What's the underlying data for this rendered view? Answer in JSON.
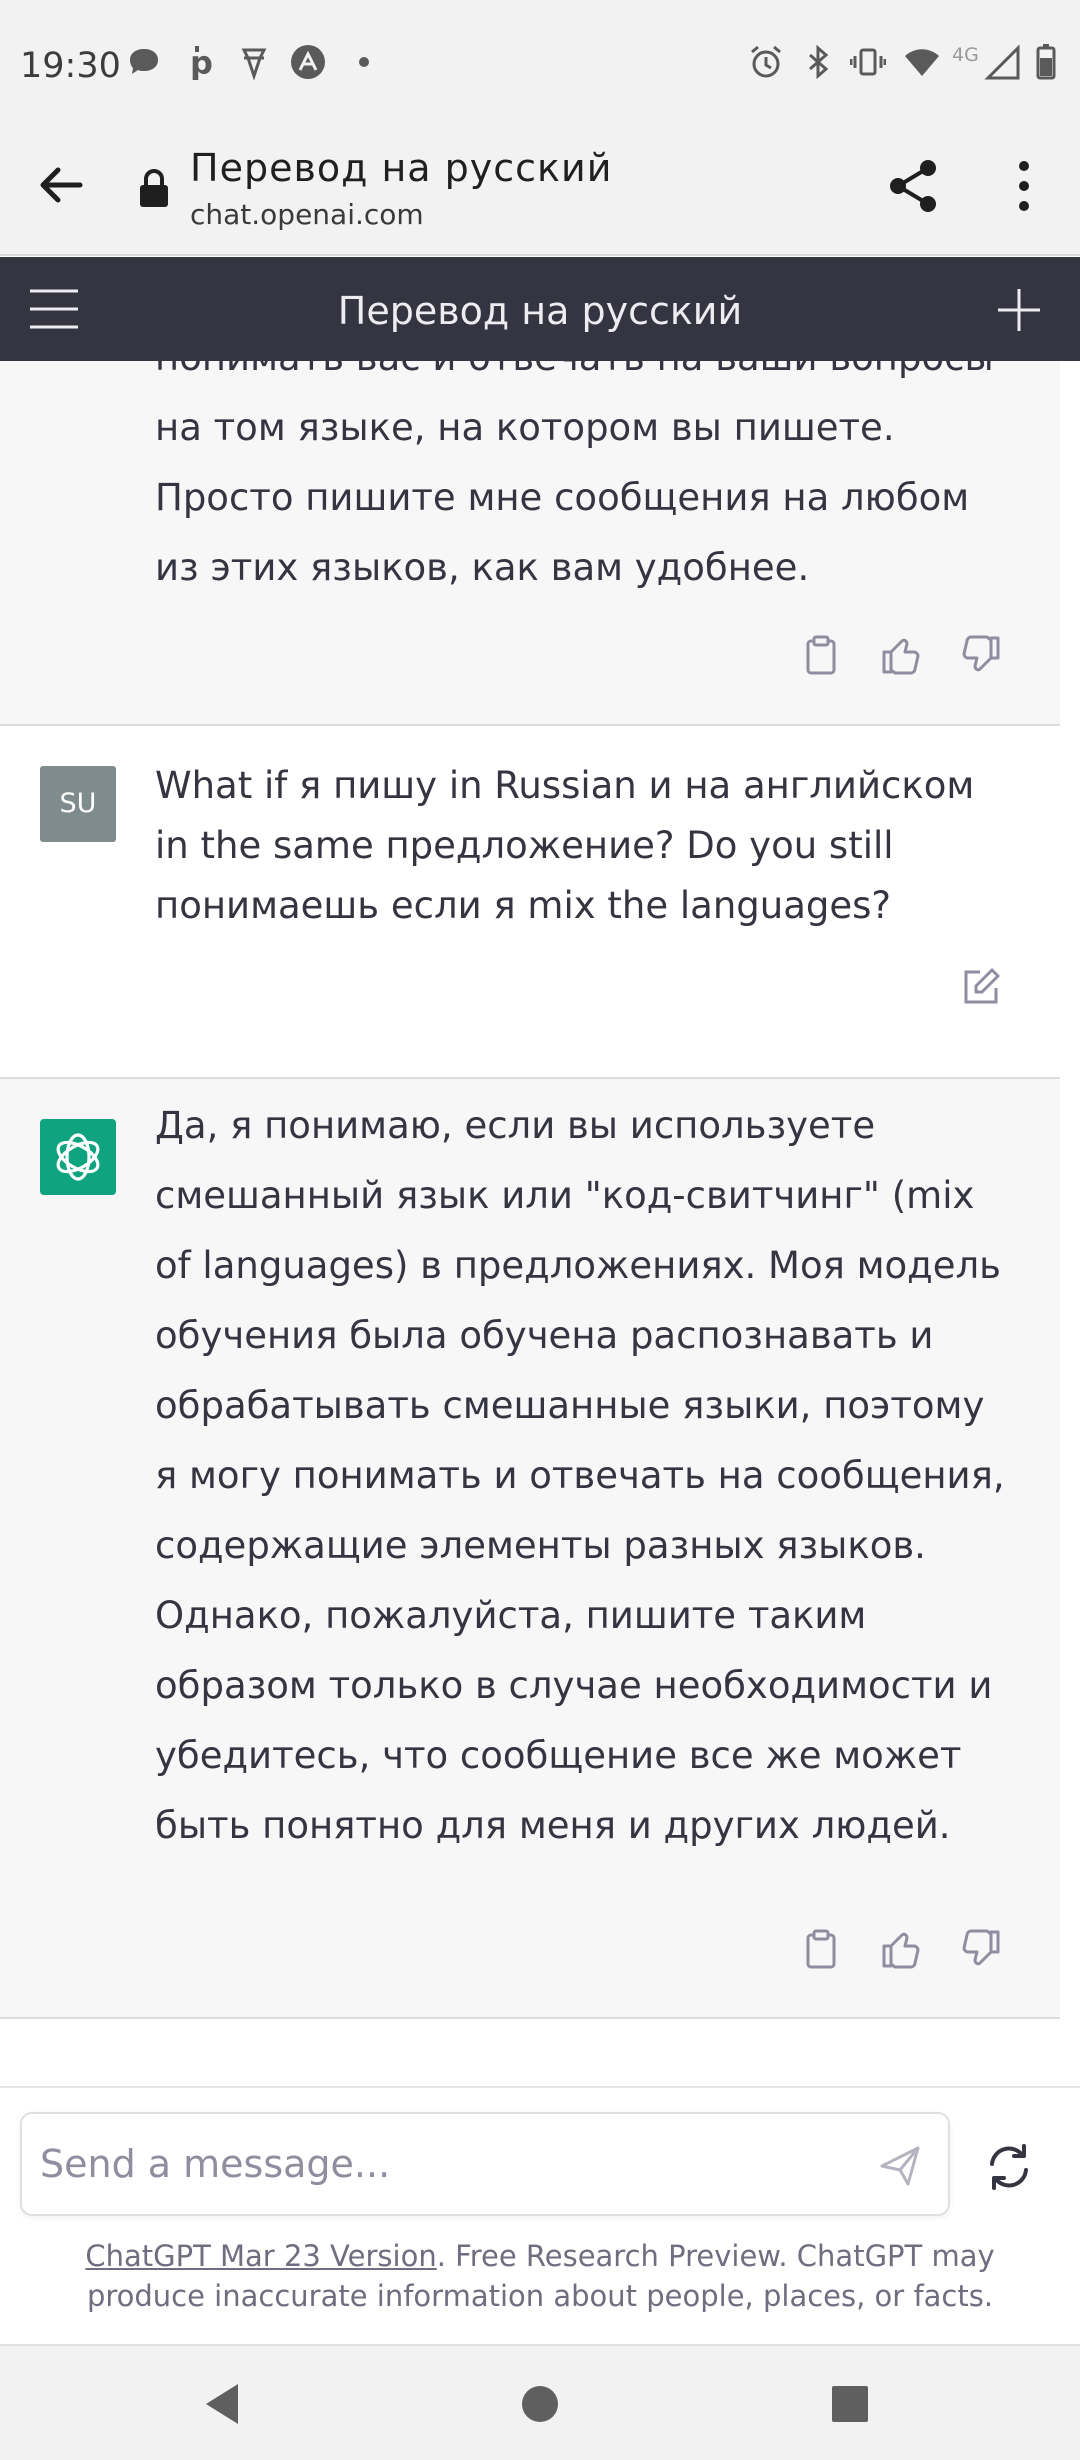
{
  "status_bar": {
    "time": "19:30",
    "network_label": "4G"
  },
  "browser": {
    "page_title": "Перевод на русский",
    "url": "chat.openai.com"
  },
  "app_header": {
    "title": "Перевод на русский"
  },
  "messages": [
    {
      "role": "assistant",
      "partial_top_line": "понимать вас и отвечать на ваши вопросы",
      "text": "на том языке, на котором вы пишете. Просто пишите мне сообщения на любом из этих языков, как вам удобнее."
    },
    {
      "role": "user",
      "avatar": "SU",
      "text": "What if я пишу in Russian и на английском in the same предложение? Do you still понимаешь если я mix the languages?"
    },
    {
      "role": "assistant",
      "text": "Да, я понимаю, если вы используете смешанный язык или \"код-свитчинг\" (mix of languages) в предложениях. Моя модель обучения была обучена распознавать и обрабатывать смешанные языки, поэтому я могу понимать и отвечать на сообщения, содержащие элементы разных языков. Однако, пожалуйста, пишите таким образом только в случае необходимости и убедитесь, что сообщение все же может быть понятно для меня и других людей."
    }
  ],
  "composer": {
    "placeholder": "Send a message...",
    "footer_link": "ChatGPT Mar 23 Version",
    "footer_text": ". Free Research Preview. ChatGPT may produce inaccurate information about people, places, or facts."
  },
  "colors": {
    "app_header_bg": "#343541",
    "assistant_bg": "#f7f7f8",
    "gpt_avatar": "#10a37f",
    "user_avatar": "#7f8c8d"
  }
}
